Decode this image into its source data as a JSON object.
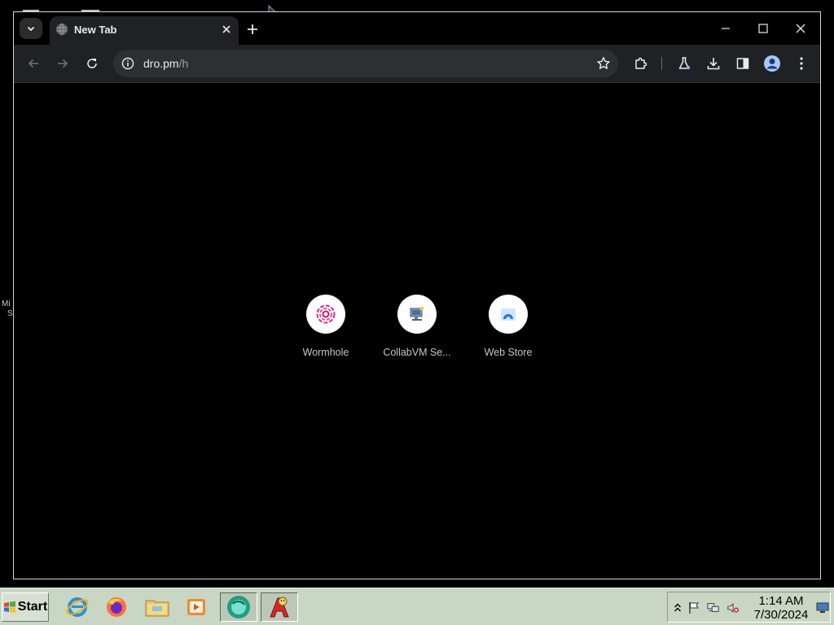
{
  "browser": {
    "tab_title": "New Tab",
    "url_host": "dro.pm",
    "url_path": "/h",
    "accent_color": "#202124"
  },
  "shortcuts": [
    {
      "label": "Wormhole",
      "icon": "wormhole-icon"
    },
    {
      "label": "CollabVM Se...",
      "icon": "collabvm-icon"
    },
    {
      "label": "Web Store",
      "icon": "web-store-icon"
    }
  ],
  "desktop": {
    "fragment_1": "Mi",
    "fragment_2": "S"
  },
  "taskbar": {
    "start_label": "Start",
    "apps": [
      "internet-explorer-icon",
      "firefox-icon",
      "file-explorer-icon",
      "media-player-icon",
      "chrome-icon",
      "paint-app-icon"
    ],
    "clock_time": "1:14 AM",
    "clock_date": "7/30/2024"
  }
}
